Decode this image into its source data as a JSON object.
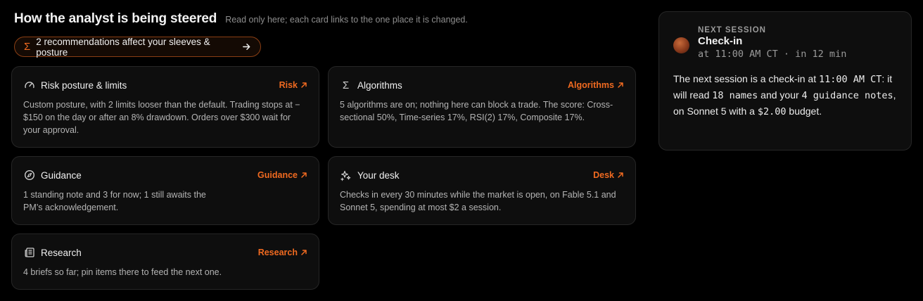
{
  "header": {
    "title": "How the analyst is being steered",
    "subtitle": "Read only here; each card links to the one place it is changed."
  },
  "recommendations": {
    "label": "2 recommendations affect your sleeves & posture",
    "icon": "sigma-icon"
  },
  "cards": {
    "risk": {
      "title": "Risk posture & limits",
      "link": "Risk",
      "body": "Custom posture, with 2 limits looser than the default. Trading stops at −$150 on the day or after an 8% drawdown. Orders over $300 wait for your approval.",
      "icon": "gauge-icon"
    },
    "algorithms": {
      "title": "Algorithms",
      "link": "Algorithms",
      "body": "5 algorithms are on; nothing here can block a trade. The score: Cross-sectional 50%, Time-series 17%, RSI(2) 17%, Composite 17%.",
      "icon": "sigma-icon"
    },
    "guidance": {
      "title": "Guidance",
      "link": "Guidance",
      "body": "1 standing note and 3 for now; 1 still awaits the PM’s acknowledgement.",
      "icon": "compass-icon"
    },
    "desk": {
      "title": "Your desk",
      "link": "Desk",
      "body": "Checks in every 30 minutes while the market is open, on Fable 5.1 and Sonnet 5, spending at most $2 a session.",
      "icon": "sparkles-icon"
    },
    "research": {
      "title": "Research",
      "link": "Research",
      "body": "4 briefs so far; pin items there to feed the next one.",
      "icon": "newspaper-icon"
    }
  },
  "session": {
    "kicker": "NEXT SESSION",
    "title": "Check-in",
    "time": "at 11:00 AM CT · in 12 min",
    "body": {
      "p1": "The next session is a check-in at ",
      "time": "11:00 AM CT",
      "p2": ": it will read ",
      "names": "18 names",
      "p3": " and your ",
      "notes": "4 guidance notes",
      "p4": ", on Sonnet 5 with a ",
      "budget": "$2.00",
      "p5": " budget."
    }
  },
  "colors": {
    "accent": "#f06a20",
    "background": "#000000",
    "card": "#0e0e0e",
    "border": "#262626"
  }
}
